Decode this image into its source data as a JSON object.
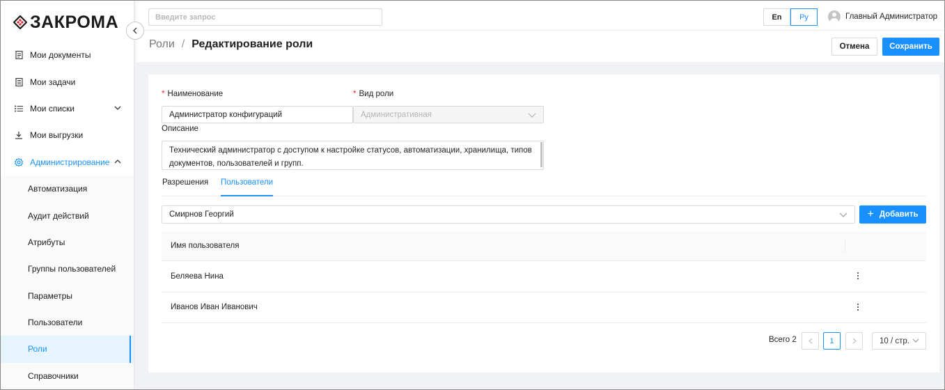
{
  "app": {
    "logo_text": "ЗАКРОМА",
    "brand_color": "#1890ff"
  },
  "header": {
    "search_placeholder": "Введите запрос",
    "lang_en": "En",
    "lang_ru": "Ру",
    "active_lang": "Ру",
    "user_name": "Главный Администратор"
  },
  "sidebar": {
    "items": [
      {
        "label": "Мои документы",
        "icon": "document-icon"
      },
      {
        "label": "Мои задачи",
        "icon": "tasks-icon"
      },
      {
        "label": "Мои списки",
        "icon": "list-icon",
        "expand": "chevron-down-icon"
      },
      {
        "label": "Мои выгрузки",
        "icon": "download-icon"
      },
      {
        "label": "Администрирование",
        "icon": "gear-icon",
        "expand": "chevron-up-icon"
      }
    ],
    "admin_items": [
      {
        "label": "Автоматизация"
      },
      {
        "label": "Аудит действий"
      },
      {
        "label": "Атрибуты"
      },
      {
        "label": "Группы пользователей"
      },
      {
        "label": "Параметры"
      },
      {
        "label": "Пользователи"
      },
      {
        "label": "Роли",
        "selected": true
      },
      {
        "label": "Справочники"
      }
    ]
  },
  "breadcrumb": {
    "parent": "Роли",
    "separator": "/",
    "current": "Редактирование роли"
  },
  "actions": {
    "cancel": "Отмена",
    "save": "Сохранить"
  },
  "form": {
    "name_label": "Наименование",
    "name_value": "Администратор конфигураций",
    "role_type_label": "Вид роли",
    "role_type_value": "Административная",
    "required_mark": "*",
    "description_label": "Описание",
    "description_value": "Технический администратор с доступом к настройке статусов, автоматизации, хранилища, типов документов, пользователей и групп."
  },
  "tabs": [
    {
      "label": "Разрешения"
    },
    {
      "label": "Пользователи",
      "active": true
    }
  ],
  "users_tab": {
    "selected_user": "Смирнов Георгий",
    "add_label": "Добавить",
    "table_header": "Имя пользователя",
    "rows": [
      "Беляева Нина",
      "Иванов Иван Иванович"
    ]
  },
  "pagination": {
    "total": "Всего 2",
    "current_page": "1",
    "page_size": "10 / стр."
  }
}
